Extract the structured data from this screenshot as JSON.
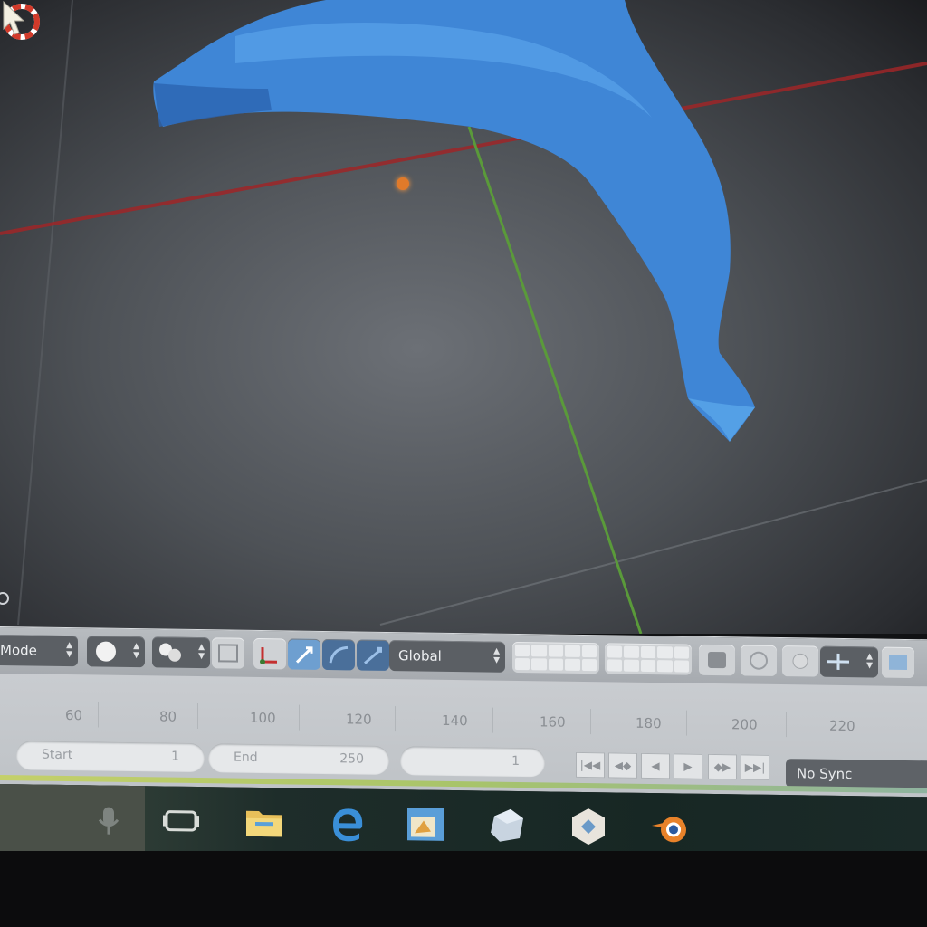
{
  "app": "Blender",
  "viewport": {
    "background": "#4e5257",
    "object_color": "#3f86d6",
    "x_axis_color": "#b3262a",
    "y_axis_color": "#5a9a3a",
    "origin_color": "#e07a2a"
  },
  "header": {
    "mode_label": "Mode",
    "orientation_label": "Global",
    "accent": "#6e9fd0"
  },
  "timeline": {
    "frame_labels": [
      "60",
      "80",
      "100",
      "120",
      "140",
      "160",
      "180",
      "200",
      "220"
    ],
    "start_label": "Start",
    "start_value": "1",
    "end_label": "End",
    "end_value": "250",
    "current_frame": "1",
    "sync_label": "No Sync"
  },
  "taskbar": {
    "icons": [
      "microphone-icon",
      "task-view-icon",
      "file-explorer-icon",
      "edge-icon",
      "paint-icon",
      "app-cube-icon",
      "app-hex-icon",
      "blender-icon"
    ]
  }
}
